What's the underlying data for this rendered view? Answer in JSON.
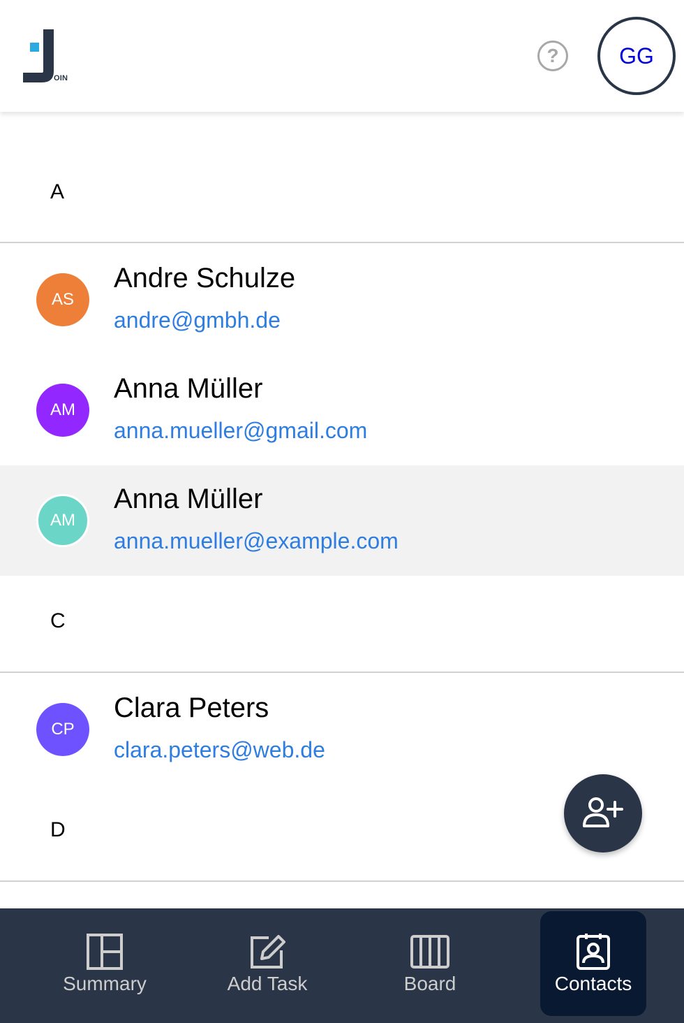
{
  "header": {
    "logo_suffix": "OIN",
    "help_label": "?",
    "user_initials": "GG"
  },
  "groups": [
    {
      "letter": "A"
    },
    {
      "letter": "C"
    },
    {
      "letter": "D"
    }
  ],
  "contacts": [
    {
      "initials": "AS",
      "name": "Andre Schulze",
      "email": "andre@gmbh.de",
      "color": "#ee7f38"
    },
    {
      "initials": "AM",
      "name": "Anna Müller",
      "email": "anna.mueller@gmail.com",
      "color": "#9327ff"
    },
    {
      "initials": "AM",
      "name": "Anna Müller",
      "email": "anna.mueller@example.com",
      "color": "#6bd6c8"
    },
    {
      "initials": "CP",
      "name": "Clara Peters",
      "email": "clara.peters@web.de",
      "color": "#6e52ff"
    }
  ],
  "fab": {
    "icon": "person-add-icon"
  },
  "nav": [
    {
      "label": "Summary",
      "icon": "summary-icon"
    },
    {
      "label": "Add Task",
      "icon": "edit-icon"
    },
    {
      "label": "Board",
      "icon": "board-icon"
    },
    {
      "label": "Contacts",
      "icon": "contacts-icon",
      "active": true
    }
  ],
  "colors": {
    "primary_dark": "#2a3647",
    "nav_active": "#091931",
    "link_blue": "#2e7de1",
    "logo_accent": "#29abe2"
  }
}
